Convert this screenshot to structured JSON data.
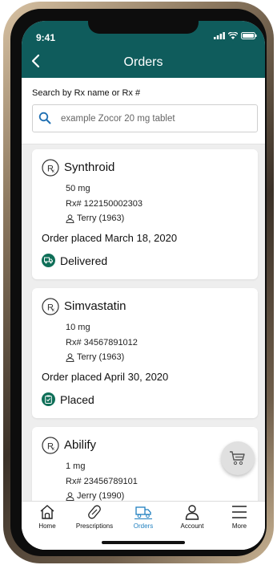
{
  "status_bar": {
    "time": "9:41"
  },
  "header": {
    "title": "Orders"
  },
  "search": {
    "label": "Search by Rx name or Rx #",
    "placeholder": "example Zocor 20 mg tablet"
  },
  "orders": [
    {
      "name": "Synthroid",
      "dose": "50 mg",
      "rx": "Rx# 122150002303",
      "patient": "Terry (1963)",
      "placed": "Order placed March 18, 2020",
      "status": "Delivered"
    },
    {
      "name": "Simvastatin",
      "dose": "10 mg",
      "rx": "Rx# 34567891012",
      "patient": "Terry (1963)",
      "placed": "Order placed April 30, 2020",
      "status": "Placed"
    },
    {
      "name": "Abilify",
      "dose": "1 mg",
      "rx": "Rx# 23456789101",
      "patient": "Jerry (1990)"
    }
  ],
  "tabs": [
    {
      "label": "Home",
      "icon": "home-icon"
    },
    {
      "label": "Prescriptions",
      "icon": "pill-icon"
    },
    {
      "label": "Orders",
      "icon": "delivery-truck-icon",
      "active": true
    },
    {
      "label": "Account",
      "icon": "person-icon"
    },
    {
      "label": "More",
      "icon": "menu-icon"
    }
  ],
  "colors": {
    "header_bg": "#0f5c5c",
    "status_green": "#0f6f58",
    "active_tab": "#1f7fbf"
  }
}
